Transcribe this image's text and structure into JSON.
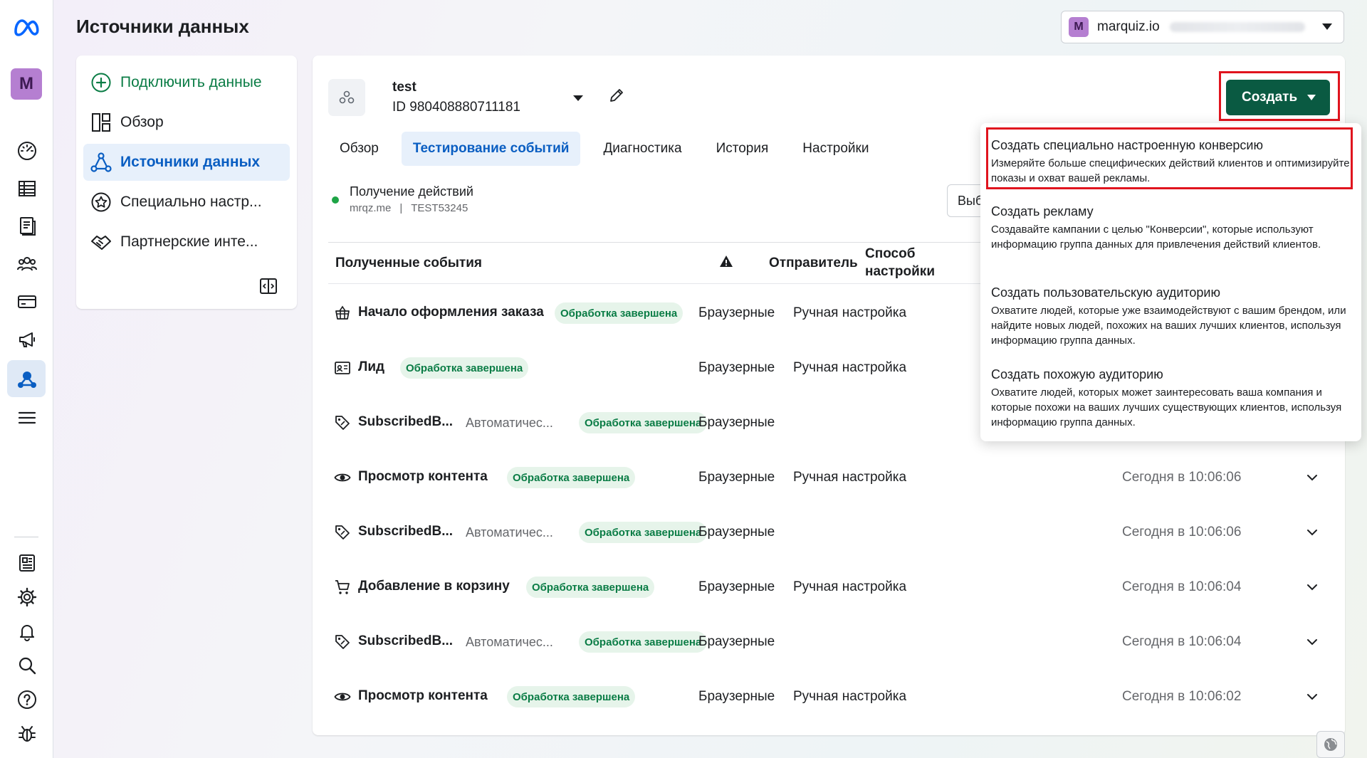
{
  "header": {
    "title": "Источники данных",
    "account": {
      "initial": "M",
      "name": "marquiz.io"
    }
  },
  "nav": {
    "items": [
      {
        "label": "Подключить данные"
      },
      {
        "label": "Обзор"
      },
      {
        "label": "Источники данных"
      },
      {
        "label": "Специально настр..."
      },
      {
        "label": "Партнерские инте..."
      }
    ]
  },
  "rail": {
    "avatar_initial": "M"
  },
  "datasource": {
    "name": "test",
    "id": "ID 980408880711181"
  },
  "tabs": [
    {
      "label": "Обзор"
    },
    {
      "label": "Тестирование событий"
    },
    {
      "label": "Диагностика"
    },
    {
      "label": "История"
    },
    {
      "label": "Настройки"
    }
  ],
  "receiving": {
    "title": "Получение действий",
    "domain": "mrqz.me",
    "divider": "|",
    "code": "TEST53245",
    "choose_label": "Выб"
  },
  "table": {
    "headers": {
      "events": "Полученные события",
      "sender": "Отправитель",
      "method_line1": "Способ",
      "method_line2": "настройки"
    },
    "rows": [
      {
        "icon": "basket-icon",
        "name": "Начало оформления заказа",
        "sub": "",
        "badge": "Обработка завершена",
        "sender": "Браузерные",
        "method": "Ручная настройка",
        "time": ""
      },
      {
        "icon": "id-card-icon",
        "name": "Лид",
        "sub": "",
        "badge": "Обработка завершена",
        "sender": "Браузерные",
        "method": "Ручная настройка",
        "time": ""
      },
      {
        "icon": "tag-icon",
        "name": "SubscribedB...",
        "sub": "Автоматичес...",
        "badge": "Обработка завершена",
        "sender": "Браузерные",
        "method": "",
        "time": ""
      },
      {
        "icon": "eye-icon",
        "name": "Просмотр контента",
        "sub": "",
        "badge": "Обработка завершена",
        "sender": "Браузерные",
        "method": "Ручная настройка",
        "time": "Сегодня в 10:06:06"
      },
      {
        "icon": "tag-icon",
        "name": "SubscribedB...",
        "sub": "Автоматичес...",
        "badge": "Обработка завершена",
        "sender": "Браузерные",
        "method": "",
        "time": "Сегодня в 10:06:06"
      },
      {
        "icon": "cart-icon",
        "name": "Добавление в корзину",
        "sub": "",
        "badge": "Обработка завершена",
        "sender": "Браузерные",
        "method": "Ручная настройка",
        "time": "Сегодня в 10:06:04"
      },
      {
        "icon": "tag-icon",
        "name": "SubscribedB...",
        "sub": "Автоматичес...",
        "badge": "Обработка завершена",
        "sender": "Браузерные",
        "method": "",
        "time": "Сегодня в 10:06:04"
      },
      {
        "icon": "eye-icon",
        "name": "Просмотр контента",
        "sub": "",
        "badge": "Обработка завершена",
        "sender": "Браузерные",
        "method": "Ручная настройка",
        "time": "Сегодня в 10:06:02"
      }
    ]
  },
  "create": {
    "label": "Создать",
    "menu": [
      {
        "title": "Создать специально настроенную конверсию",
        "desc": "Измеряйте больше специфических действий клиентов и оптимизируйте показы и охват вашей рекламы."
      },
      {
        "title": "Создать рекламу",
        "desc": "Создавайте кампании с целью \"Конверсии\", которые используют информацию группа данных для привлечения действий клиентов."
      },
      {
        "title": "Создать пользовательскую аудиторию",
        "desc": "Охватите людей, которые уже взаимодействуют с вашим брендом, или найдите новых людей, похожих на ваших лучших клиентов, используя информацию группа данных."
      },
      {
        "title": "Создать похожую аудиторию",
        "desc": "Охватите людей, которых может заинтересовать ваша компания и которые похожи на ваших лучших существующих клиентов, используя информацию группа данных."
      }
    ]
  },
  "colors": {
    "accent_blue": "#0a5ec2",
    "primary_green": "#0a5a42",
    "success_green": "#0a7c45",
    "highlight_red": "#e0141e"
  }
}
